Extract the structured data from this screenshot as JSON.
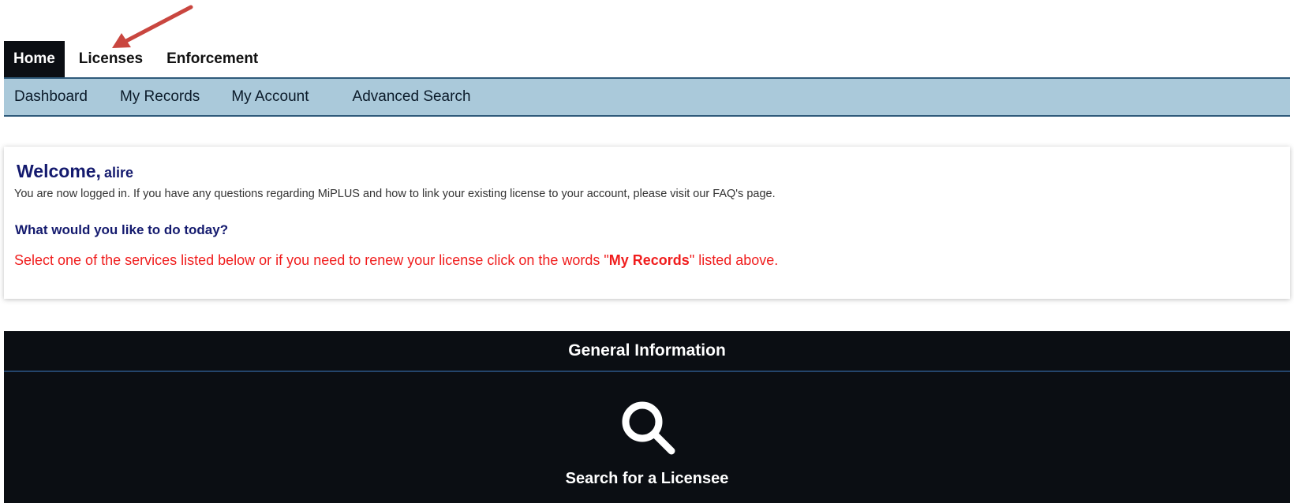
{
  "top_nav": {
    "tabs": [
      {
        "label": "Home",
        "active": true
      },
      {
        "label": "Licenses",
        "active": false
      },
      {
        "label": "Enforcement",
        "active": false
      }
    ]
  },
  "sub_nav": {
    "items": [
      {
        "label": "Dashboard"
      },
      {
        "label": "My Records"
      },
      {
        "label": "My Account"
      },
      {
        "label": "Advanced Search"
      }
    ]
  },
  "welcome": {
    "title": "Welcome,",
    "username": "alire",
    "message": "You are now logged in. If you have any questions regarding MiPLUS and how to link your existing license to your account, please visit our FAQ's page.",
    "question": "What would you like to do today?",
    "instruction_before": "Select one of the services listed below or if you need to renew your license click on the words \"",
    "instruction_emphasis": "My Records",
    "instruction_after": "\" listed above."
  },
  "general_info": {
    "header": "General Information",
    "search_label": "Search for a Licensee",
    "search_icon": "search-icon"
  },
  "colors": {
    "dark_panel": "#0b0e13",
    "subnav_bg": "#aac9da",
    "heading_blue": "#141a6e",
    "instruction_red": "#f01d1d",
    "annotation_arrow": "#c9463f"
  }
}
